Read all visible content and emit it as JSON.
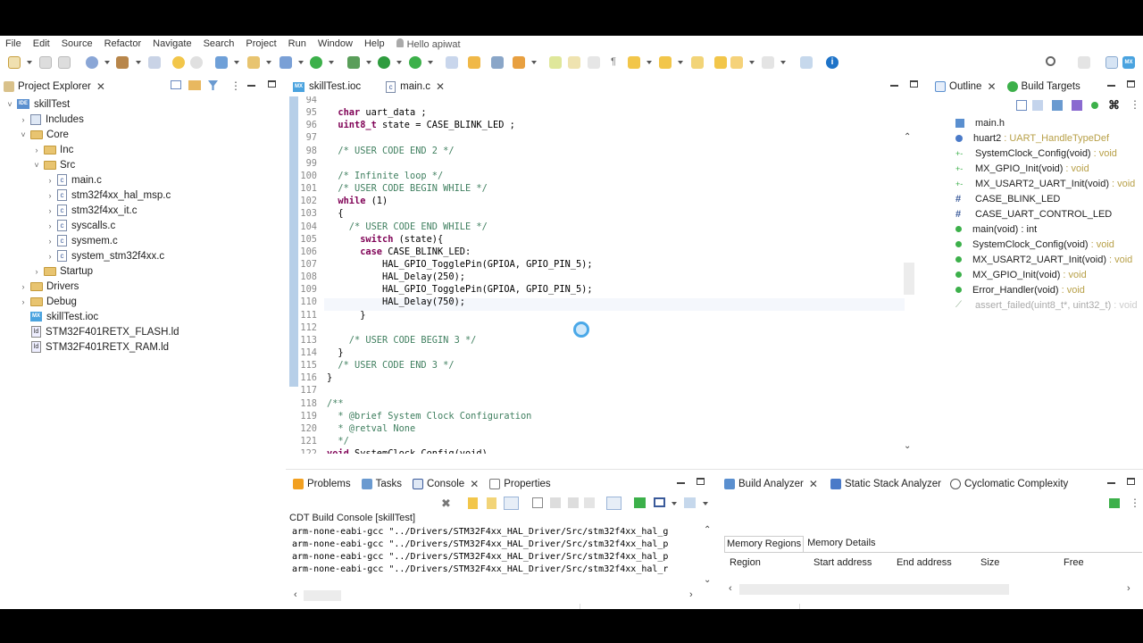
{
  "menu": [
    "File",
    "Edit",
    "Source",
    "Refactor",
    "Navigate",
    "Search",
    "Project",
    "Run",
    "Window",
    "Help"
  ],
  "user": "Hello apiwat",
  "project_explorer": {
    "title": "Project Explorer",
    "items": [
      {
        "label": "skillTest",
        "icon": "project-icon",
        "chev": "˅"
      },
      {
        "label": "Includes",
        "icon": "includes-icon",
        "chev": "›"
      },
      {
        "label": "Core",
        "icon": "folder-icon",
        "chev": "˅"
      },
      {
        "label": "Inc",
        "icon": "folder-icon",
        "chev": "›"
      },
      {
        "label": "Src",
        "icon": "folder-icon",
        "chev": "˅"
      },
      {
        "label": "main.c",
        "icon": "c-file-icon",
        "chev": "›"
      },
      {
        "label": "stm32f4xx_hal_msp.c",
        "icon": "c-file-icon",
        "chev": "›"
      },
      {
        "label": "stm32f4xx_it.c",
        "icon": "c-file-icon",
        "chev": "›"
      },
      {
        "label": "syscalls.c",
        "icon": "c-file-icon",
        "chev": "›"
      },
      {
        "label": "sysmem.c",
        "icon": "c-file-icon",
        "chev": "›"
      },
      {
        "label": "system_stm32f4xx.c",
        "icon": "c-file-icon",
        "chev": "›"
      },
      {
        "label": "Startup",
        "icon": "folder-icon",
        "chev": "›"
      },
      {
        "label": "Drivers",
        "icon": "folder-icon",
        "chev": "›"
      },
      {
        "label": "Debug",
        "icon": "folder-icon",
        "chev": "›"
      },
      {
        "label": "skillTest.ioc",
        "icon": "mx-file-icon",
        "chev": ""
      },
      {
        "label": "STM32F401RETX_FLASH.ld",
        "icon": "ld-file-icon",
        "chev": ""
      },
      {
        "label": "STM32F401RETX_RAM.ld",
        "icon": "ld-file-icon",
        "chev": ""
      }
    ]
  },
  "editor": {
    "tabs": [
      "skillTest.ioc",
      "main.c"
    ],
    "lines": [
      {
        "n": "94",
        "t": ""
      },
      {
        "n": "95",
        "t": "  char uart_data ;"
      },
      {
        "n": "96",
        "t": "  uint8_t state = CASE_BLINK_LED ;"
      },
      {
        "n": "97",
        "t": ""
      },
      {
        "n": "98",
        "t": "  /* USER CODE END 2 */"
      },
      {
        "n": "99",
        "t": ""
      },
      {
        "n": "100",
        "t": "  /* Infinite loop */"
      },
      {
        "n": "101",
        "t": "  /* USER CODE BEGIN WHILE */"
      },
      {
        "n": "102",
        "t": "  while (1)"
      },
      {
        "n": "103",
        "t": "  {"
      },
      {
        "n": "104",
        "t": "    /* USER CODE END WHILE */"
      },
      {
        "n": "105",
        "t": "      switch (state){"
      },
      {
        "n": "106",
        "t": "      case CASE_BLINK_LED:"
      },
      {
        "n": "107",
        "t": "          HAL_GPIO_TogglePin(GPIOA, GPIO_PIN_5);"
      },
      {
        "n": "108",
        "t": "          HAL_Delay(250);"
      },
      {
        "n": "109",
        "t": "          HAL_GPIO_TogglePin(GPIOA, GPIO_PIN_5);"
      },
      {
        "n": "110",
        "t": "          HAL_Delay(750);"
      },
      {
        "n": "111",
        "t": "      }"
      },
      {
        "n": "112",
        "t": ""
      },
      {
        "n": "113",
        "t": "    /* USER CODE BEGIN 3 */"
      },
      {
        "n": "114",
        "t": "  }"
      },
      {
        "n": "115",
        "t": "  /* USER CODE END 3 */"
      },
      {
        "n": "116",
        "t": "}"
      },
      {
        "n": "117",
        "t": ""
      },
      {
        "n": "118",
        "t": "/**"
      },
      {
        "n": "119",
        "t": "  * @brief System Clock Configuration"
      },
      {
        "n": "120",
        "t": "  * @retval None"
      },
      {
        "n": "121",
        "t": "  */"
      },
      {
        "n": "122",
        "t": "void SystemClock_Config(void)"
      }
    ]
  },
  "outline": {
    "tabs": [
      "Outline",
      "Build Targets"
    ],
    "items": [
      {
        "label": "main.h",
        "type": ""
      },
      {
        "label": "huart2",
        "type": ": UART_HandleTypeDef"
      },
      {
        "label": "SystemClock_Config(void)",
        "type": ": void"
      },
      {
        "label": "MX_GPIO_Init(void)",
        "type": ": void"
      },
      {
        "label": "MX_USART2_UART_Init(void)",
        "type": ": void"
      },
      {
        "label": "CASE_BLINK_LED",
        "type": ""
      },
      {
        "label": "CASE_UART_CONTROL_LED",
        "type": ""
      },
      {
        "label": "main(void) : int",
        "type": ""
      },
      {
        "label": "SystemClock_Config(void)",
        "type": ": void"
      },
      {
        "label": "MX_USART2_UART_Init(void)",
        "type": ": void"
      },
      {
        "label": "MX_GPIO_Init(void)",
        "type": ": void"
      },
      {
        "label": "Error_Handler(void)",
        "type": ": void"
      },
      {
        "label": "assert_failed(uint8_t*, uint32_t)",
        "type": ": void"
      }
    ]
  },
  "console": {
    "tabs": [
      "Problems",
      "Tasks",
      "Console",
      "Properties"
    ],
    "title": "CDT Build Console [skillTest]",
    "lines": [
      "arm-none-eabi-gcc \"../Drivers/STM32F4xx_HAL_Driver/Src/stm32f4xx_hal_g",
      "arm-none-eabi-gcc \"../Drivers/STM32F4xx_HAL_Driver/Src/stm32f4xx_hal_p",
      "arm-none-eabi-gcc \"../Drivers/STM32F4xx_HAL_Driver/Src/stm32f4xx_hal_p",
      "arm-none-eabi-gcc \"../Drivers/STM32F4xx_HAL_Driver/Src/stm32f4xx_hal_r"
    ]
  },
  "analyzer": {
    "tabs": [
      "Build Analyzer",
      "Static Stack Analyzer",
      "Cyclomatic Complexity"
    ],
    "subtabs": [
      "Memory Regions",
      "Memory Details"
    ],
    "columns": [
      "Region",
      "Start address",
      "End address",
      "Size",
      "Free"
    ]
  }
}
